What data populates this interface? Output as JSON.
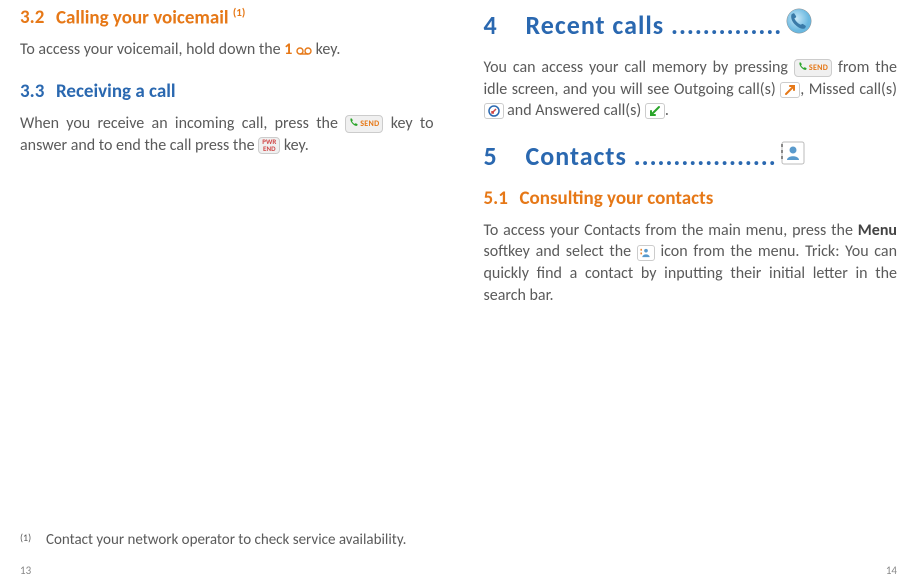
{
  "left": {
    "s32": {
      "num": "3.2",
      "title": "Calling your voicemail",
      "sup": "(1)",
      "body_a": "To access your voicemail, hold down the ",
      "key1": "1",
      "body_b": " key."
    },
    "s33": {
      "num": "3.3",
      "title": "Receiving a call",
      "body_a": "When you receive an incoming call, press the ",
      "body_b": " key to answer and to end the call press the ",
      "body_c": " key."
    },
    "footnote": {
      "marker": "(1)",
      "text": "Contact your network operator to check service availability."
    },
    "pagenum": "13"
  },
  "right": {
    "s4": {
      "num": "4",
      "title": "Recent calls ..............",
      "body_a": "You can access your call memory by pressing ",
      "body_b": " from the idle screen, and you will see Outgoing call(s) ",
      "body_c": ", Missed call(s) ",
      "body_d": " and Answered call(s) ",
      "body_e": "."
    },
    "s5": {
      "num": "5",
      "title": "Contacts ..................",
      "s51": {
        "num": "5.1",
        "title": "Consulting your contacts",
        "body_a": "To access your Contacts from the main menu, press the ",
        "menu": "Menu",
        "body_b": " softkey and select the ",
        "body_c": " icon from the menu. Trick: You can quickly find a contact by inputting their initial letter in the search bar."
      }
    },
    "pagenum": "14"
  },
  "icons": {
    "send": "SEND",
    "pwr": "PWR",
    "end": "END"
  }
}
